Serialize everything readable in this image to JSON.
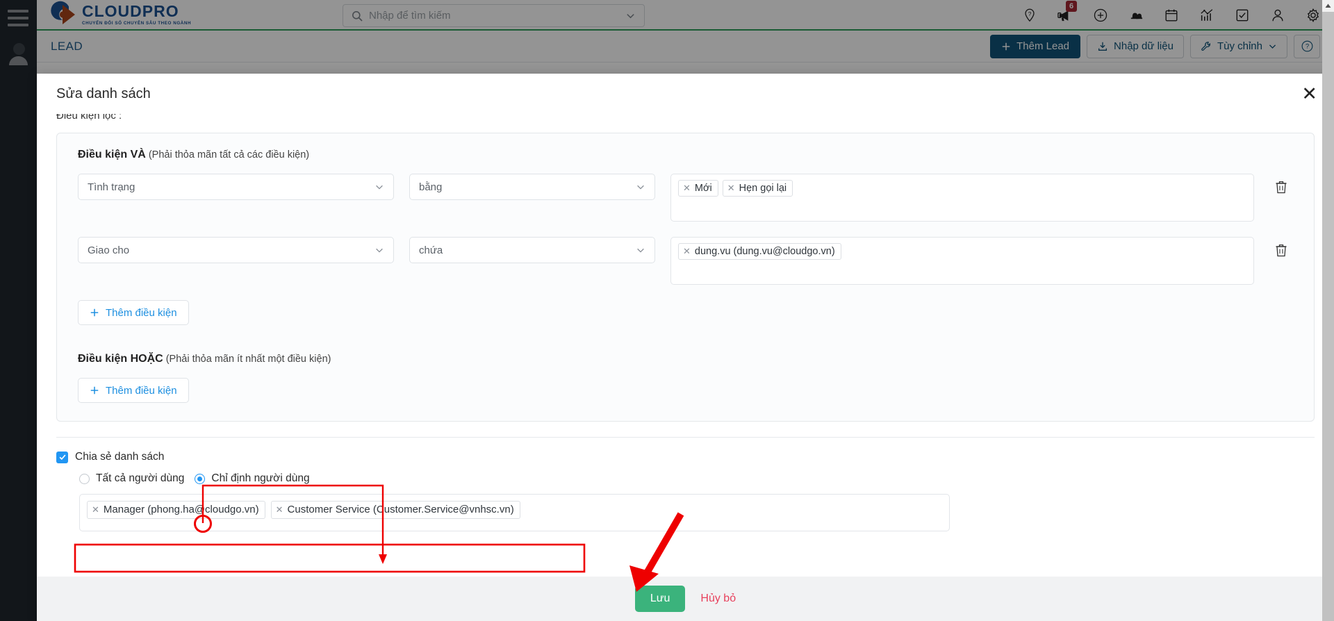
{
  "app": {
    "logo": {
      "name": "CLOUDPRO",
      "tagline": "CHUYỂN ĐỔI SỐ CHUYÊN SÂU THEO NGÀNH"
    },
    "search": {
      "placeholder": "Nhập để tìm kiếm"
    },
    "topbar_icons": [
      {
        "name": "help-location-icon",
        "label": "?"
      },
      {
        "name": "megaphone-icon",
        "badge": "6"
      },
      {
        "name": "plus-circle-icon"
      },
      {
        "name": "bells-icon"
      },
      {
        "name": "calendar-icon"
      },
      {
        "name": "analytics-icon"
      },
      {
        "name": "task-check-icon"
      },
      {
        "name": "user-icon"
      },
      {
        "name": "gear-icon"
      }
    ]
  },
  "page": {
    "title": "LEAD",
    "actions": {
      "add_lead": "Thêm Lead",
      "import": "Nhập dữ liệu",
      "customize": "Tùy chỉnh",
      "help": "?"
    }
  },
  "modal": {
    "title": "Sửa danh sách",
    "close_label": "✕",
    "filter_label": "Điều kiện lọc :",
    "and_group": {
      "title": "Điều kiện VÀ",
      "hint": "(Phải thỏa mãn tất cả các điều kiện)",
      "conditions": [
        {
          "field": "Tình trạng",
          "operator": "bằng",
          "values": [
            "Mới",
            "Hẹn gọi lại"
          ]
        },
        {
          "field": "Giao cho",
          "operator": "chứa",
          "values": [
            "dung.vu (dung.vu@cloudgo.vn)"
          ]
        }
      ],
      "add_label": "Thêm điều kiện"
    },
    "or_group": {
      "title": "Điều kiện HOẶC",
      "hint": "(Phải thỏa mãn ít nhất một điều kiện)",
      "conditions": [],
      "add_label": "Thêm điều kiện"
    },
    "share": {
      "checkbox_label": "Chia sẻ danh sách",
      "checked": true,
      "options": [
        {
          "label": "Tất cả người dùng",
          "selected": false
        },
        {
          "label": "Chỉ định người dùng",
          "selected": true
        }
      ],
      "selected_users": [
        "Manager (phong.ha@cloudgo.vn)",
        "Customer Service (Customer.Service@vnhsc.vn)"
      ]
    },
    "footer": {
      "save": "Lưu",
      "cancel": "Hủy bỏ"
    }
  },
  "colors": {
    "brand_blue": "#1c5192",
    "brand_orange": "#a8441a",
    "primary_button": "#105479",
    "save_green": "#3bb37c",
    "cancel_red": "#e8415c",
    "link_blue": "#1d8fe0",
    "badge_red": "#a42834",
    "annotation_red": "#ee0000",
    "accent_green_rule": "#2e9e5b"
  }
}
